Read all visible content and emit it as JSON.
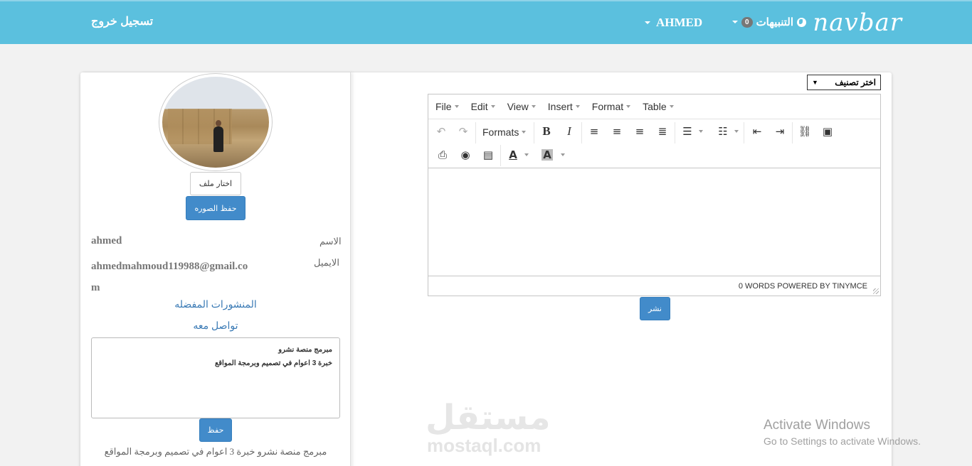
{
  "navbar": {
    "logout": "تسجيل خروج",
    "brand": "navbar",
    "notifications_label": "التنبيهات",
    "notifications_count": "0",
    "username": "AHMED"
  },
  "profile": {
    "choose_file": "اختار ملف",
    "save_photo": "حفظ الصوره",
    "name_label": "الاسم",
    "name_value": "ahmed",
    "email_label": "الايميل",
    "email_value_line1": "ahmedmahmoud119988@gmail.co",
    "email_value_line2": "m",
    "favorites_link": "المنشورات المفضله",
    "contact_link": "تواصل معه",
    "bio_line1": "مبرمج منصة نشرو",
    "bio_line2": "خبرة 3 اعوام في تصميم وبرمجة المواقع",
    "save_bio": "حفظ",
    "bio_display": "مبرمج منصة نشرو خبرة 3 اعوام في تصميم وبرمجة المواقع"
  },
  "editor": {
    "category_select": "اختر تصنيف",
    "menu": [
      "File",
      "Edit",
      "View",
      "Insert",
      "Format",
      "Table"
    ],
    "formats_label": "Formats",
    "status": "0 WORDS POWERED BY TINYMCE",
    "publish": "نشر"
  },
  "watermarks": {
    "mostaql_ar": "مستقل",
    "mostaql_en": "mostaql.com",
    "activate_title": "Activate Windows",
    "activate_sub": "Go to Settings to activate Windows."
  }
}
